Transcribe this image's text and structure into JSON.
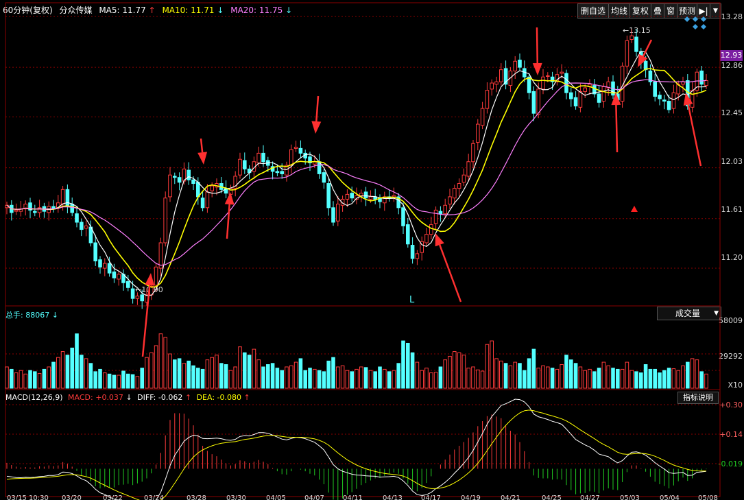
{
  "header": {
    "title": "60分钟(复权)",
    "stock": "分众传媒",
    "ma5_label": "MA5: 11.77",
    "ma10_label": "MA10: 11.71",
    "ma20_label": "MA20: 11.75",
    "up_arrow": "↑",
    "down_arrow": "↓"
  },
  "toolbar": {
    "del_fav": "删自选",
    "ma_line": "均线",
    "restore": "复权",
    "overlay": "叠",
    "window": "窗",
    "forecast": "预测",
    "nav": "▶|",
    "dropdown": "▼"
  },
  "volume_panel": {
    "total_label": "总手: 88067",
    "selector": "成交量",
    "dropdown": "▼",
    "axis": [
      "58009",
      "29292"
    ],
    "multiplier": "X10"
  },
  "macd_panel": {
    "title": "MACD(12,26,9)",
    "macd_label": "MACD: +0.037",
    "diff_label": "DIFF: -0.062",
    "dea_label": "DEA: -0.080",
    "help_button": "指标说明",
    "axis": [
      "+0.30",
      "+0.14",
      "-0.019"
    ]
  },
  "price_axis": [
    "13.28",
    "12.86",
    "12.45",
    "12.03",
    "11.61",
    "11.20"
  ],
  "current_price": "12.93",
  "annotations": {
    "high_label": "13.15",
    "low_label": "10.90",
    "low_marker": "L"
  },
  "colors": {
    "up": "#ff3b3b",
    "down": "#54ffff",
    "ma5": "#ffffff",
    "ma10": "#ffff00",
    "ma20": "#ff80ff",
    "grid": "#8b0000",
    "arrow": "#ff3030",
    "macd_up": "#ff3b3b",
    "macd_down": "#22cc22"
  },
  "chart_data": {
    "type": "candlestick",
    "ylim": [
      10.9,
      13.28
    ],
    "x_tick_labels": [
      "03/15 10:30",
      "03/20",
      "03/22",
      "03/24",
      "03/28",
      "03/30",
      "04/05",
      "04/07",
      "04/11",
      "04/13",
      "04/17",
      "04/19",
      "04/21",
      "04/25",
      "04/27",
      "05/03",
      "05/04",
      "05/08"
    ],
    "close": [
      11.72,
      11.66,
      11.68,
      11.69,
      11.73,
      11.68,
      11.66,
      11.7,
      11.67,
      11.71,
      11.69,
      11.74,
      11.85,
      11.72,
      11.66,
      11.58,
      11.52,
      11.55,
      11.41,
      11.26,
      11.21,
      11.24,
      11.16,
      11.12,
      11.15,
      11.08,
      11.04,
      10.95,
      10.97,
      10.93,
      10.98,
      11.05,
      11.21,
      11.41,
      11.78,
      11.97,
      11.95,
      11.91,
      12.02,
      11.93,
      11.9,
      11.79,
      11.7,
      11.83,
      11.88,
      11.9,
      11.85,
      11.82,
      11.86,
      11.96,
      12.1,
      12.02,
      11.99,
      12.08,
      12.15,
      12.08,
      12.05,
      12.0,
      11.99,
      11.98,
      12.05,
      12.18,
      12.2,
      12.15,
      12.11,
      12.07,
      12.08,
      11.98,
      11.91,
      11.7,
      11.58,
      11.73,
      11.77,
      11.81,
      11.78,
      11.8,
      11.82,
      11.78,
      11.79,
      11.77,
      11.75,
      11.79,
      11.78,
      11.8,
      11.7,
      11.55,
      11.4,
      11.28,
      11.32,
      11.42,
      11.48,
      11.56,
      11.68,
      11.65,
      11.72,
      11.79,
      11.86,
      11.9,
      11.97,
      12.08,
      12.23,
      12.39,
      12.52,
      12.67,
      12.73,
      12.74,
      12.84,
      12.72,
      12.83,
      12.91,
      12.86,
      12.78,
      12.65,
      12.48,
      12.68,
      12.78,
      12.79,
      12.74,
      12.8,
      12.82,
      12.65,
      12.6,
      12.54,
      12.66,
      12.69,
      12.72,
      12.64,
      12.57,
      12.7,
      12.74,
      12.63,
      12.59,
      12.87,
      13.08,
      13.12,
      12.99,
      12.9,
      12.84,
      12.74,
      12.62,
      12.6,
      12.58,
      12.51,
      12.65,
      12.72,
      12.74,
      12.54,
      12.67,
      12.82,
      12.72,
      12.75
    ],
    "volume": [
      18000,
      16000,
      13000,
      15000,
      12000,
      15000,
      14000,
      12500,
      16000,
      18000,
      22000,
      26000,
      31000,
      28000,
      34000,
      46000,
      28000,
      25000,
      21000,
      14000,
      16000,
      13000,
      12000,
      11000,
      11000,
      14500,
      12000,
      11500,
      10000,
      17000,
      26000,
      30000,
      36000,
      46000,
      43000,
      29000,
      24000,
      25000,
      21000,
      23000,
      19000,
      17000,
      16000,
      24000,
      26000,
      28000,
      21000,
      20000,
      15000,
      18000,
      35000,
      30000,
      28000,
      33000,
      24000,
      18000,
      20000,
      21000,
      17000,
      15000,
      18000,
      19000,
      22000,
      25000,
      15000,
      17000,
      16000,
      15000,
      14000,
      23000,
      26000,
      18000,
      19000,
      15000,
      14000,
      16000,
      18000,
      17500,
      15000,
      14000,
      18000,
      16000,
      14000,
      15000,
      21000,
      40000,
      38000,
      30000,
      22000,
      15000,
      17000,
      13000,
      13500,
      18000,
      24000,
      27000,
      31000,
      30000,
      28000,
      17000,
      18000,
      15500,
      14500,
      37000,
      40000,
      25000,
      23000,
      21000,
      19000,
      22000,
      21000,
      15000,
      25000,
      33000,
      17000,
      19000,
      18000,
      17000,
      16000,
      20000,
      28000,
      24000,
      21000,
      18000,
      15000,
      16000,
      14000,
      17000,
      22000,
      19000,
      17000,
      16000,
      16000,
      22000,
      15000,
      14000,
      13000,
      20000,
      16000,
      16000,
      13000,
      15000,
      17000,
      16500,
      15000,
      19000,
      22000,
      25000,
      24000,
      14000,
      12000
    ],
    "macd_ylim": [
      -0.12,
      0.32
    ],
    "diff": [
      -0.036,
      -0.039,
      -0.042,
      -0.043,
      -0.041,
      -0.042,
      -0.041,
      -0.037,
      -0.036,
      -0.032,
      -0.032,
      -0.028,
      -0.016,
      -0.017,
      -0.023,
      -0.034,
      -0.048,
      -0.057,
      -0.075,
      -0.098,
      -0.115,
      -0.123,
      -0.135,
      -0.146,
      -0.15,
      -0.158,
      -0.165,
      -0.177,
      -0.182,
      -0.186,
      -0.183,
      -0.173,
      -0.15,
      -0.112,
      -0.051,
      0.015,
      0.064,
      0.098,
      0.132,
      0.15,
      0.16,
      0.157,
      0.145,
      0.144,
      0.145,
      0.147,
      0.144,
      0.138,
      0.136,
      0.141,
      0.155,
      0.158,
      0.157,
      0.164,
      0.173,
      0.173,
      0.17,
      0.161,
      0.152,
      0.142,
      0.138,
      0.145,
      0.151,
      0.149,
      0.144,
      0.135,
      0.127,
      0.11,
      0.09,
      0.056,
      0.02,
      0.0,
      -0.012,
      -0.019,
      -0.026,
      -0.03,
      -0.031,
      -0.034,
      -0.035,
      -0.036,
      -0.04,
      -0.039,
      -0.038,
      -0.036,
      -0.042,
      -0.058,
      -0.08,
      -0.107,
      -0.124,
      -0.128,
      -0.124,
      -0.113,
      -0.095,
      -0.082,
      -0.065,
      -0.045,
      -0.021,
      0.001,
      0.026,
      0.054,
      0.088,
      0.128,
      0.169,
      0.213,
      0.25,
      0.276,
      0.303,
      0.311,
      0.322,
      0.333,
      0.331,
      0.32,
      0.297,
      0.262,
      0.249,
      0.243,
      0.236,
      0.227,
      0.221,
      0.213,
      0.19,
      0.165,
      0.14,
      0.127,
      0.114,
      0.104,
      0.089,
      0.07,
      0.064,
      0.058,
      0.042,
      0.028,
      0.039,
      0.061,
      0.079,
      0.081,
      0.075,
      0.065,
      0.048,
      0.029,
      0.013,
      -0.001,
      -0.019,
      -0.022,
      -0.02,
      -0.017,
      -0.032,
      -0.031,
      -0.017,
      -0.015,
      -0.012
    ],
    "dea": [
      -0.05,
      -0.048,
      -0.047,
      -0.046,
      -0.045,
      -0.045,
      -0.044,
      -0.043,
      -0.041,
      -0.04,
      -0.038,
      -0.036,
      -0.032,
      -0.029,
      -0.028,
      -0.029,
      -0.033,
      -0.038,
      -0.045,
      -0.056,
      -0.068,
      -0.079,
      -0.09,
      -0.101,
      -0.111,
      -0.12,
      -0.129,
      -0.138,
      -0.147,
      -0.155,
      -0.16,
      -0.162,
      -0.16,
      -0.15,
      -0.131,
      -0.102,
      -0.069,
      -0.035,
      0.0,
      0.03,
      0.056,
      0.076,
      0.09,
      0.101,
      0.11,
      0.117,
      0.122,
      0.125,
      0.128,
      0.13,
      0.135,
      0.14,
      0.143,
      0.147,
      0.152,
      0.156,
      0.159,
      0.159,
      0.158,
      0.155,
      0.152,
      0.151,
      0.151,
      0.151,
      0.15,
      0.147,
      0.143,
      0.136,
      0.127,
      0.113,
      0.094,
      0.076,
      0.059,
      0.043,
      0.03,
      0.018,
      0.008,
      0.0,
      -0.007,
      -0.013,
      -0.018,
      -0.022,
      -0.025,
      -0.027,
      -0.03,
      -0.035,
      -0.044,
      -0.057,
      -0.07,
      -0.082,
      -0.09,
      -0.095,
      -0.095,
      -0.092,
      -0.087,
      -0.079,
      -0.067,
      -0.054,
      -0.038,
      -0.02,
      0.001,
      0.026,
      0.055,
      0.087,
      0.12,
      0.151,
      0.182,
      0.208,
      0.231,
      0.251,
      0.267,
      0.278,
      0.281,
      0.278,
      0.271,
      0.266,
      0.259,
      0.253,
      0.246,
      0.239,
      0.229,
      0.216,
      0.201,
      0.186,
      0.172,
      0.158,
      0.144,
      0.129,
      0.116,
      0.105,
      0.092,
      0.079,
      0.071,
      0.069,
      0.071,
      0.073,
      0.074,
      0.072,
      0.067,
      0.06,
      0.05,
      0.04,
      0.028,
      0.018,
      0.01,
      0.004,
      -0.003,
      -0.008,
      -0.01,
      -0.011,
      -0.011
    ]
  }
}
